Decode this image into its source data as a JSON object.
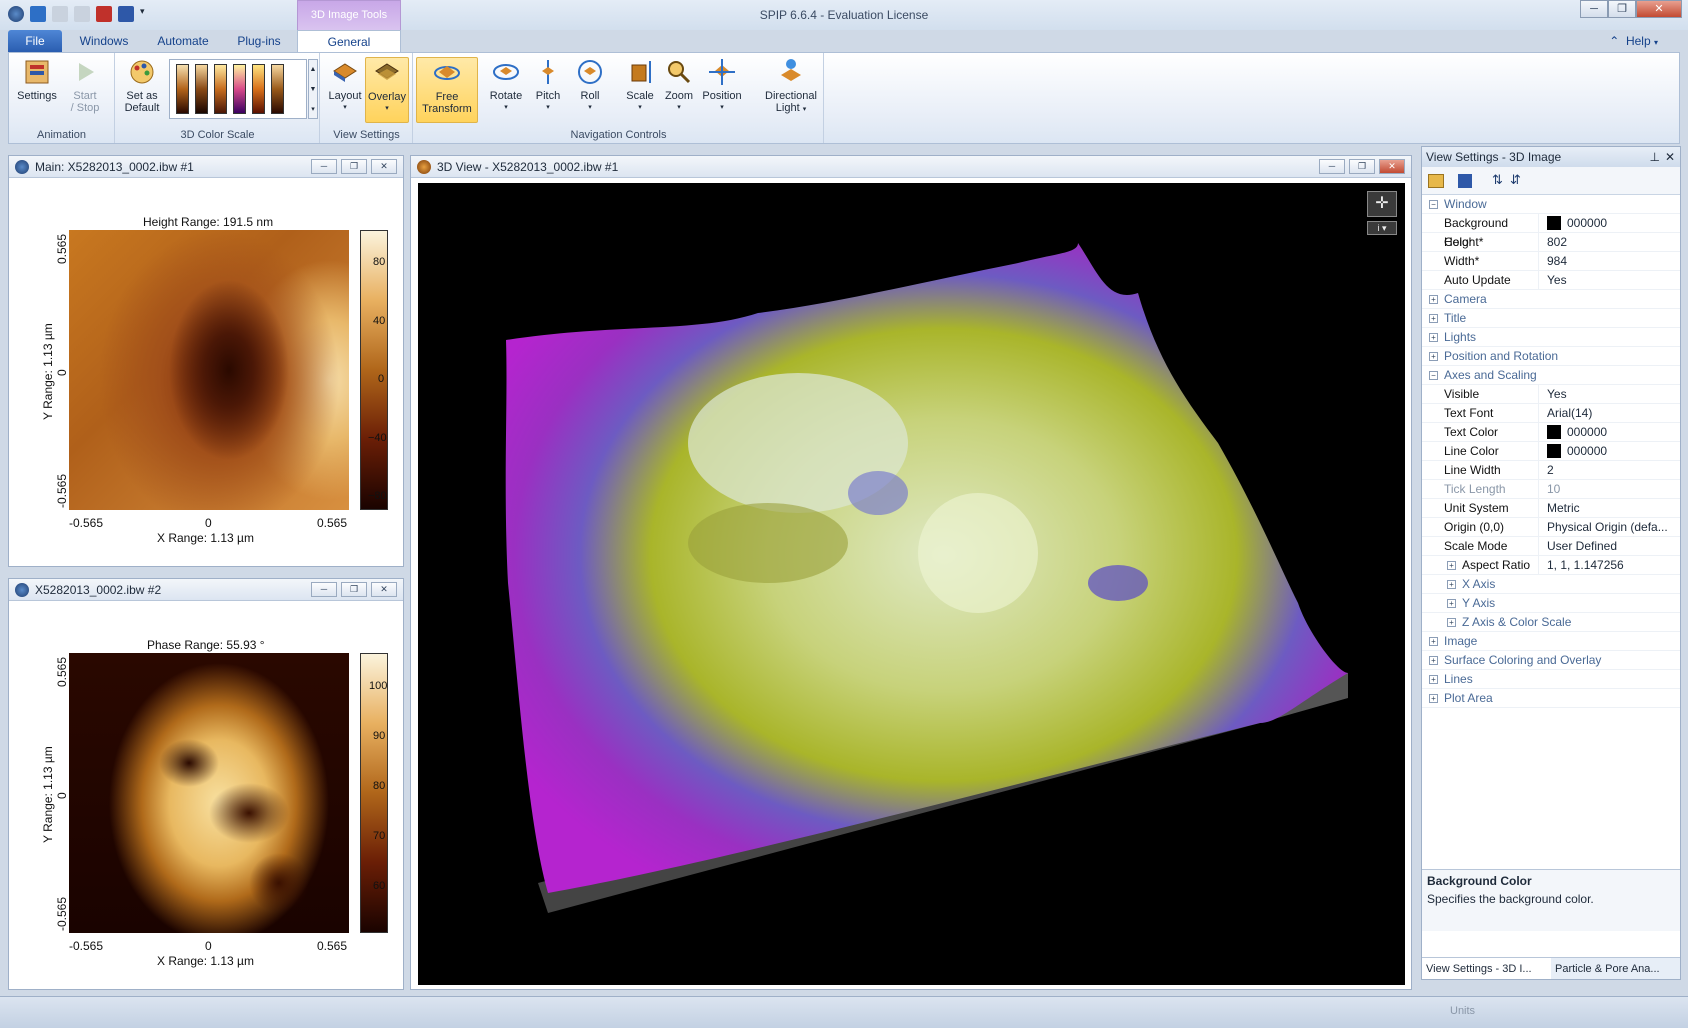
{
  "app": {
    "title": "SPIP 6.6.4 - Evaluation License",
    "context_tab_group": "3D Image Tools",
    "help": "Help"
  },
  "tabs": [
    "File",
    "Windows",
    "Automate",
    "Plug-ins",
    "General"
  ],
  "ribbon": {
    "animation": {
      "label": "Animation",
      "settings": "Settings",
      "start_stop_1": "Start",
      "start_stop_2": "/ Stop"
    },
    "color_scale": {
      "label": "3D Color Scale",
      "set_default_1": "Set as",
      "set_default_2": "Default"
    },
    "view_settings": {
      "label": "View Settings",
      "layout": "Layout",
      "overlay": "Overlay"
    },
    "navigation": {
      "label": "Navigation Controls",
      "free_1": "Free",
      "free_2": "Transform",
      "rotate": "Rotate",
      "pitch": "Pitch",
      "roll": "Roll",
      "scale": "Scale",
      "zoom": "Zoom",
      "position": "Position",
      "dir_1": "Directional",
      "dir_2": "Light"
    }
  },
  "main_panel": {
    "title": "Main: X5282013_0002.ibw #1",
    "chart_title": "Height Range:  191.5 nm",
    "xlabel": "X Range:  1.13 µm",
    "ylabel": "Y Range:  1.13 µm",
    "xticks": [
      "-0.565",
      "0",
      "0.565"
    ],
    "yticks": [
      "0.565",
      "0",
      "-0.565"
    ],
    "cbticks": [
      "80",
      "40",
      "0",
      "−40",
      "−80"
    ]
  },
  "phase_panel": {
    "title": "X5282013_0002.ibw #2",
    "chart_title": "Phase Range:  55.93 °",
    "xlabel": "X Range:  1.13 µm",
    "ylabel": "Y Range:  1.13 µm",
    "xticks": [
      "-0.565",
      "0",
      "0.565"
    ],
    "yticks": [
      "0.565",
      "0",
      "-0.565"
    ],
    "cbticks": [
      "100",
      "90",
      "80",
      "70",
      "60"
    ]
  },
  "view3d": {
    "title": "3D View - X5282013_0002.ibw #1"
  },
  "props": {
    "title": "View Settings - 3D Image",
    "rows": [
      {
        "type": "cat",
        "k": "Window",
        "open": true
      },
      {
        "k": "Background Color",
        "v": "000000",
        "swatch": true
      },
      {
        "k": "Height*",
        "v": "802"
      },
      {
        "k": "Width*",
        "v": "984"
      },
      {
        "k": "Auto Update",
        "v": "Yes"
      },
      {
        "type": "cat",
        "k": "Camera"
      },
      {
        "type": "cat",
        "k": "Title"
      },
      {
        "type": "cat",
        "k": "Lights"
      },
      {
        "type": "cat",
        "k": "Position and Rotation"
      },
      {
        "type": "cat",
        "k": "Axes and Scaling",
        "open": true
      },
      {
        "k": "Visible",
        "v": "Yes"
      },
      {
        "k": "Text Font",
        "v": "Arial(14)"
      },
      {
        "k": "Text Color",
        "v": "000000",
        "swatch": true
      },
      {
        "k": "Line Color",
        "v": "000000",
        "swatch": true
      },
      {
        "k": "Line Width",
        "v": "2"
      },
      {
        "k": "Tick Length",
        "v": "10",
        "gray": true
      },
      {
        "k": "Unit System",
        "v": "Metric"
      },
      {
        "k": "Origin (0,0)",
        "v": "Physical Origin (defa..."
      },
      {
        "k": "Scale Mode",
        "v": "User Defined"
      },
      {
        "type": "sub",
        "k": "Aspect Ratio",
        "v": "1, 1, 1.147256"
      },
      {
        "type": "subcat",
        "k": "X Axis"
      },
      {
        "type": "subcat",
        "k": "Y Axis"
      },
      {
        "type": "subcat",
        "k": "Z Axis & Color Scale"
      },
      {
        "type": "cat",
        "k": "Image"
      },
      {
        "type": "cat",
        "k": "Surface Coloring and Overlay"
      },
      {
        "type": "cat",
        "k": "Lines"
      },
      {
        "type": "cat",
        "k": "Plot Area"
      }
    ],
    "desc_title": "Background Color",
    "desc_text": "Specifies the background color.",
    "bottom_tabs": [
      "View Settings - 3D I...",
      "Particle & Pore Ana..."
    ],
    "units": "Units"
  }
}
